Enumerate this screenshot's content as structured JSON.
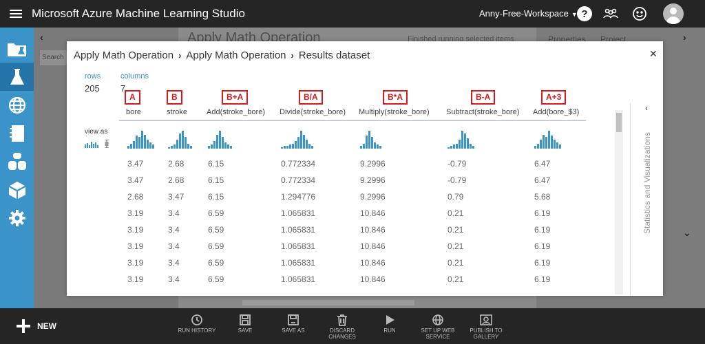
{
  "app": {
    "title": "Microsoft Azure Machine Learning Studio",
    "workspace": "Anny-Free-Workspace",
    "help_label": "?"
  },
  "background": {
    "canvas_title": "Apply Math Operation",
    "status": "Finished running selected items",
    "tabs": [
      "Properties",
      "Project"
    ],
    "search_placeholder": "Search"
  },
  "modal": {
    "breadcrumb": [
      "Apply Math Operation",
      "Apply Math Operation",
      "Results dataset"
    ],
    "rows_label": "rows",
    "rows_value": "205",
    "columns_label": "columns",
    "columns_value": "7",
    "view_as": "view as",
    "side_panel": "Statistics and Visualizations",
    "columns": [
      {
        "tag": "A",
        "header": "bore"
      },
      {
        "tag": "B",
        "header": "stroke"
      },
      {
        "tag": "B+A",
        "header": "Add(stroke_bore)"
      },
      {
        "tag": "B/A",
        "header": "Divide(stroke_bore)"
      },
      {
        "tag": "B*A",
        "header": "Multiply(stroke_bore)"
      },
      {
        "tag": "B-A",
        "header": "Subtract(stroke_bore)"
      },
      {
        "tag": "A+3",
        "header": "Add(bore_$3)"
      }
    ],
    "rows": [
      [
        "3.47",
        "2.68",
        "6.15",
        "0.772334",
        "9.2996",
        "-0.79",
        "6.47"
      ],
      [
        "3.47",
        "2.68",
        "6.15",
        "0.772334",
        "9.2996",
        "-0.79",
        "6.47"
      ],
      [
        "2.68",
        "3.47",
        "6.15",
        "1.294776",
        "9.2996",
        "0.79",
        "5.68"
      ],
      [
        "3.19",
        "3.4",
        "6.59",
        "1.065831",
        "10.846",
        "0.21",
        "6.19"
      ],
      [
        "3.19",
        "3.4",
        "6.59",
        "1.065831",
        "10.846",
        "0.21",
        "6.19"
      ],
      [
        "3.19",
        "3.4",
        "6.59",
        "1.065831",
        "10.846",
        "0.21",
        "6.19"
      ],
      [
        "3.19",
        "3.4",
        "6.59",
        "1.065831",
        "10.846",
        "0.21",
        "6.19"
      ],
      [
        "3.19",
        "3.4",
        "6.59",
        "1.065831",
        "10.846",
        "0.21",
        "6.19"
      ]
    ],
    "histograms": [
      [
        2,
        4,
        6,
        10,
        9,
        14,
        11,
        7,
        5,
        3
      ],
      [
        1,
        2,
        3,
        7,
        12,
        14,
        9,
        4,
        2
      ],
      [
        2,
        3,
        6,
        11,
        14,
        9,
        5,
        3,
        2
      ],
      [
        1,
        2,
        2,
        3,
        4,
        6,
        9,
        14,
        11,
        7,
        4,
        2
      ],
      [
        2,
        4,
        10,
        14,
        9,
        5,
        3,
        2
      ],
      [
        1,
        2,
        3,
        4,
        7,
        14,
        12,
        8,
        4,
        2
      ],
      [
        2,
        4,
        7,
        11,
        9,
        14,
        10,
        7,
        5,
        3
      ]
    ],
    "colors": {
      "tag": "#d9191c",
      "hist": "#3a93c9",
      "link": "#3a93c9"
    }
  },
  "bottom": {
    "new_label": "NEW",
    "actions": [
      {
        "icon": "clock-icon",
        "label": "RUN HISTORY"
      },
      {
        "icon": "save-icon",
        "label": "SAVE"
      },
      {
        "icon": "save-as-icon",
        "label": "SAVE AS"
      },
      {
        "icon": "trash-icon",
        "label": "DISCARD CHANGES"
      },
      {
        "icon": "play-icon",
        "label": "RUN"
      },
      {
        "icon": "globe-icon",
        "label": "SET UP WEB SERVICE"
      },
      {
        "icon": "gallery-icon",
        "label": "PUBLISH TO GALLERY"
      }
    ]
  }
}
